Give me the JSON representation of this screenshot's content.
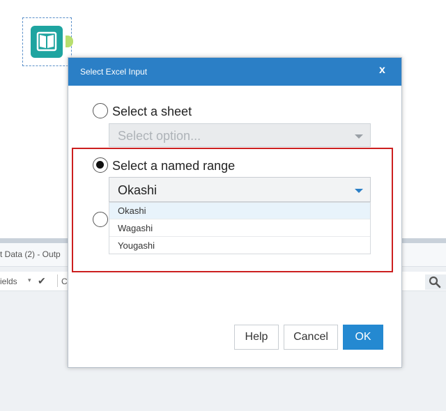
{
  "dialog": {
    "title": "Select Excel Input",
    "close_label": "x",
    "options": {
      "sheet": {
        "label": "Select a sheet",
        "selected": false,
        "placeholder": "Select option..."
      },
      "named_range": {
        "label": "Select a named range",
        "selected": true,
        "value": "Okashi"
      }
    },
    "named_range_list": [
      "Okashi",
      "Wagashi",
      "Yougashi"
    ],
    "buttons": {
      "help": "Help",
      "cancel": "Cancel",
      "ok": "OK"
    }
  },
  "background": {
    "results_header": "t Data (2) - Outp",
    "toolbar_fields": "ields",
    "toolbar_c": "C"
  },
  "colors": {
    "title_bar": "#2b7fc6",
    "primary_button": "#2489d1",
    "highlight": "#cc1f1f",
    "tool_icon": "#1ea4a0",
    "dropdown_arrow": "#2b7fc6"
  },
  "icons": [
    "book-icon",
    "search-icon",
    "check-icon",
    "close-icon",
    "chevron-down-icon"
  ]
}
